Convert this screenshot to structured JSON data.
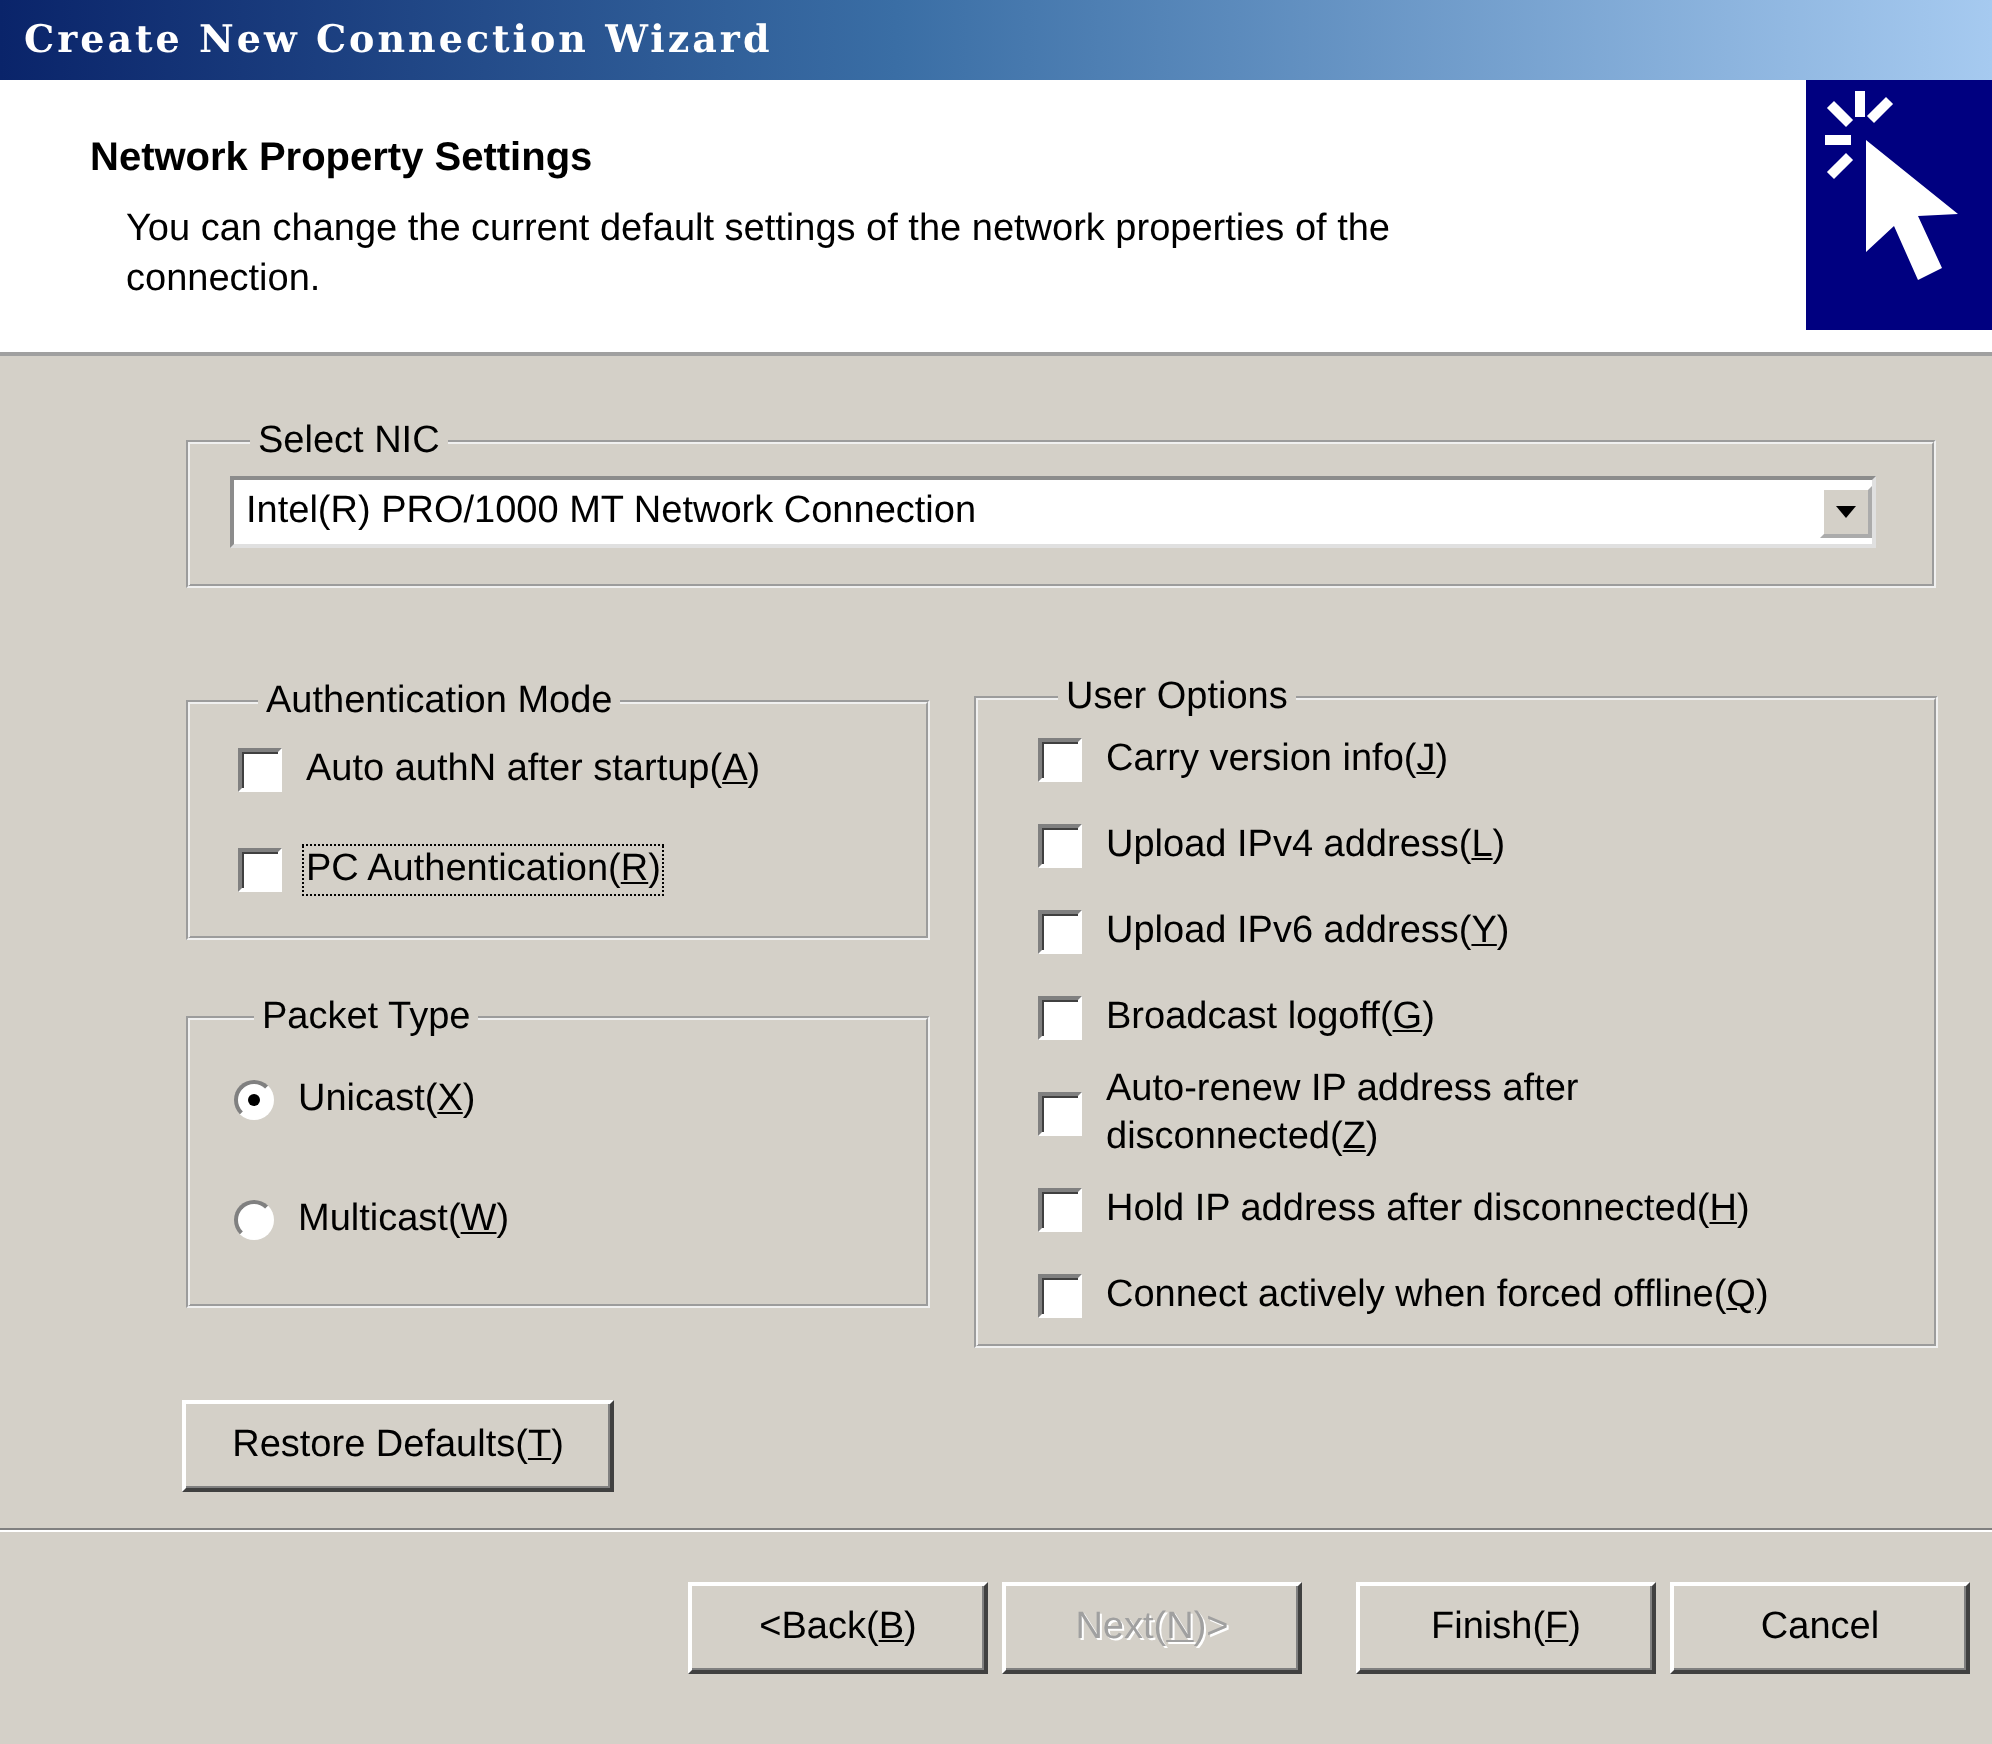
{
  "window": {
    "title": "Create New Connection Wizard"
  },
  "header": {
    "title": "Network Property Settings",
    "description": "You can change the current default settings of the network properties of the connection."
  },
  "nic_group": {
    "legend": "Select NIC",
    "value": "Intel(R) PRO/1000 MT Network Connection"
  },
  "authentication_mode": {
    "legend": "Authentication Mode",
    "options": [
      {
        "text": "Auto authN after startup(",
        "key": "A",
        "end": ")",
        "checked": false,
        "focused": false
      },
      {
        "text": "PC Authentication(",
        "key": "R",
        "end": ")",
        "checked": false,
        "focused": true
      }
    ]
  },
  "packet_type": {
    "legend": "Packet Type",
    "options": [
      {
        "text": "Unicast(",
        "key": "X",
        "end": ")",
        "selected": true
      },
      {
        "text": "Multicast(",
        "key": "W",
        "end": ")",
        "selected": false
      }
    ]
  },
  "user_options": {
    "legend": "User Options",
    "options": [
      {
        "text": "Carry version info(",
        "key": "J",
        "end": ")",
        "checked": false
      },
      {
        "text": "Upload IPv4 address(",
        "key": "L",
        "end": ")",
        "checked": false
      },
      {
        "text": "Upload IPv6 address(",
        "key": "Y",
        "end": ")",
        "checked": false
      },
      {
        "text": "Broadcast logoff(",
        "key": "G",
        "end": ")",
        "checked": false
      },
      {
        "text": "Auto-renew IP address after disconnected(",
        "key": "Z",
        "end": ")",
        "checked": false
      },
      {
        "text": "Hold IP address after disconnected(",
        "key": "H",
        "end": ")",
        "checked": false
      },
      {
        "text": "Connect actively when forced offline(",
        "key": "Q",
        "end": ")",
        "checked": false
      }
    ]
  },
  "restore_button": {
    "text": "Restore Defaults(",
    "key": "T",
    "end": ")"
  },
  "buttons": [
    {
      "text": "<Back(",
      "key": "B",
      "end": ")",
      "disabled": false
    },
    {
      "text": "Next(",
      "key": "N",
      "end": ")>",
      "disabled": true
    },
    {
      "text": "Finish(",
      "key": "F",
      "end": ")",
      "disabled": false
    },
    {
      "text": "Cancel",
      "disabled": false
    }
  ]
}
